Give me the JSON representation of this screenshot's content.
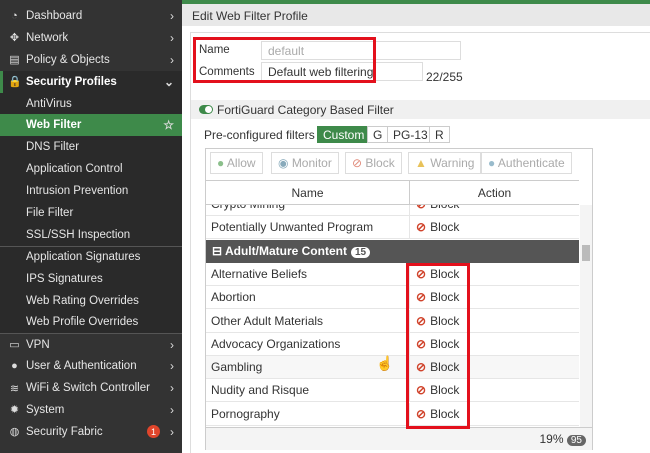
{
  "sidebar": {
    "items": [
      {
        "label": "Dashboard",
        "icon": "dashboard-icon"
      },
      {
        "label": "Network",
        "icon": "network-icon"
      },
      {
        "label": "Policy & Objects",
        "icon": "policy-icon"
      },
      {
        "label": "Security Profiles",
        "icon": "lock-icon"
      },
      {
        "label": "AntiVirus"
      },
      {
        "label": "Web Filter"
      },
      {
        "label": "DNS Filter"
      },
      {
        "label": "Application Control"
      },
      {
        "label": "Intrusion Prevention"
      },
      {
        "label": "File Filter"
      },
      {
        "label": "SSL/SSH Inspection"
      },
      {
        "label": "Application Signatures"
      },
      {
        "label": "IPS Signatures"
      },
      {
        "label": "Web Rating Overrides"
      },
      {
        "label": "Web Profile Overrides"
      },
      {
        "label": "VPN",
        "icon": "laptop-icon"
      },
      {
        "label": "User & Authentication",
        "icon": "user-icon"
      },
      {
        "label": "WiFi & Switch Controller",
        "icon": "wifi-icon"
      },
      {
        "label": "System",
        "icon": "gear-icon"
      },
      {
        "label": "Security Fabric",
        "icon": "fabric-icon",
        "badge": "1"
      }
    ]
  },
  "header": {
    "title": "Edit Web Filter Profile"
  },
  "form": {
    "name_label": "Name",
    "name_value": "default",
    "comments_label": "Comments",
    "comments_value": "Default web filtering.",
    "char_count": "22/255"
  },
  "section": {
    "title": "FortiGuard Category Based Filter"
  },
  "filters": {
    "label": "Pre-configured filters",
    "options": [
      "Custom",
      "G",
      "PG-13",
      "R"
    ]
  },
  "toolbar": {
    "allow": "Allow",
    "monitor": "Monitor",
    "block": "Block",
    "warning": "Warning",
    "authenticate": "Authenticate"
  },
  "table": {
    "col_name": "Name",
    "col_action": "Action",
    "rows_before": [
      {
        "name": "Crypto Mining",
        "action": "Block"
      },
      {
        "name": "Potentially Unwanted Program",
        "action": "Block"
      }
    ],
    "group": {
      "name": "Adult/Mature Content",
      "count": "15"
    },
    "rows": [
      {
        "name": "Alternative Beliefs",
        "action": "Block"
      },
      {
        "name": "Abortion",
        "action": "Block"
      },
      {
        "name": "Other Adult Materials",
        "action": "Block"
      },
      {
        "name": "Advocacy Organizations",
        "action": "Block"
      },
      {
        "name": "Gambling",
        "action": "Block"
      },
      {
        "name": "Nudity and Risque",
        "action": "Block"
      },
      {
        "name": "Pornography",
        "action": "Block"
      }
    ],
    "footer_percent": "19%",
    "footer_total": "95"
  }
}
